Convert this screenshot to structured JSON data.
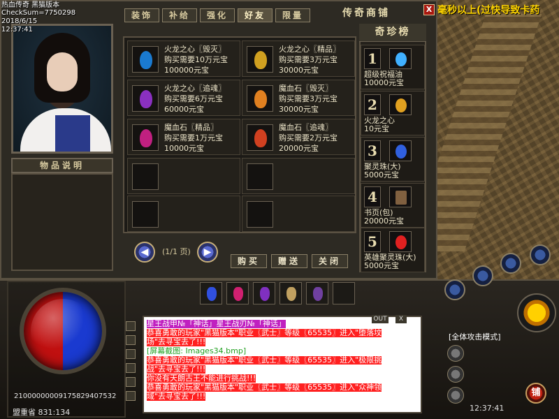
{
  "info": {
    "title": "热血传奇 黑猫版本",
    "checksum": "CheckSum=7750298",
    "date": "2018/6/15",
    "time": "12:37:41"
  },
  "notice": "毫秒以上(过快导致卡药",
  "shop": {
    "title": "传奇商铺",
    "close": "X",
    "tabs": [
      "装饰",
      "补给",
      "强化",
      "好友",
      "限量"
    ],
    "item_desc_header": "物品说明",
    "items": [
      {
        "name": "火龙之心〖毁灭〗",
        "price_line": "购买需要10万元宝",
        "amount": "100000元宝",
        "color": "#1a7ad0"
      },
      {
        "name": "火龙之心〖精品〗",
        "price_line": "购买需要3万元宝",
        "amount": "30000元宝",
        "color": "#d0a020"
      },
      {
        "name": "火龙之心〖追魂〗",
        "price_line": "购买需要6万元宝",
        "amount": "60000元宝",
        "color": "#8a30c0"
      },
      {
        "name": "魔血石〖毁灭〗",
        "price_line": "购买需要3万元宝",
        "amount": "30000元宝",
        "color": "#e08020"
      },
      {
        "name": "魔血石〖精品〗",
        "price_line": "购买需要1万元宝",
        "amount": "10000元宝",
        "color": "#c02080"
      },
      {
        "name": "魔血石〖追魂〗",
        "price_line": "购买需要2万元宝",
        "amount": "20000元宝",
        "color": "#d04020"
      }
    ],
    "page_info": "(1/1 页)",
    "buy": "购买",
    "gift": "赠送",
    "close_btn": "关闭",
    "rank_title": "奇珍榜",
    "rank": [
      {
        "num": "1",
        "name": "超级祝福油",
        "price": "10000元宝",
        "color": "#40b0ff"
      },
      {
        "name": "火龙之心",
        "num": "2",
        "price": "10元宝",
        "color": "#e0a020"
      },
      {
        "num": "3",
        "name": "聚灵珠(大)",
        "price": "5000元宝",
        "color": "#3060e0"
      },
      {
        "num": "4",
        "name": "书页(包)",
        "price": "20000元宝",
        "color": "#806040"
      },
      {
        "num": "5",
        "name": "英雄聚灵珠(大)",
        "price": "5000元宝",
        "color": "#e02020"
      }
    ]
  },
  "hud": {
    "stats": "21000000009175829407532",
    "location": "盟重省 831:134",
    "attack_mode": "[全体攻击模式]",
    "clock": "12:37:41",
    "shop_button": "铺",
    "chat_out": "OUT",
    "chat_close": "X"
  },
  "chat": [
    {
      "text": "星王战甲№「神话」星王战刃№「神话」",
      "fg": "#ffffff",
      "bg": "#c020c0"
    },
    {
      "text": "恭喜勇敢的玩家\"黑猫版本\"职业〖武士〗等级〖65535〗进入\"堕落坟",
      "fg": "#ffffff",
      "bg": "#ff2020"
    },
    {
      "text": "场\"去寻宝去了!!!",
      "fg": "#ffffff",
      "bg": "#ff2020"
    },
    {
      "text": "[屏幕截图: Images34.bmp]",
      "fg": "#20a020",
      "bg": "#ffffff"
    },
    {
      "text": "恭喜勇敢的玩家\"黑猫版本\"职业〖武士〗等级〖65535〗进入\"极限挑",
      "fg": "#ffffff",
      "bg": "#ff2020"
    },
    {
      "text": "战\"去寻宝去了!!!",
      "fg": "#ffffff",
      "bg": "#ff2020"
    },
    {
      "text": "你没有天朗古王不能进行挑战!!!",
      "fg": "#ffffff",
      "bg": "#ff2020"
    },
    {
      "text": "恭喜勇敢的玩家\"黑猫版本\"职业〖武士〗等级〖65535〗进入\"众神领",
      "fg": "#ffffff",
      "bg": "#ff2020"
    },
    {
      "text": "域\"去寻宝去了!!!",
      "fg": "#ffffff",
      "bg": "#ff2020"
    }
  ]
}
